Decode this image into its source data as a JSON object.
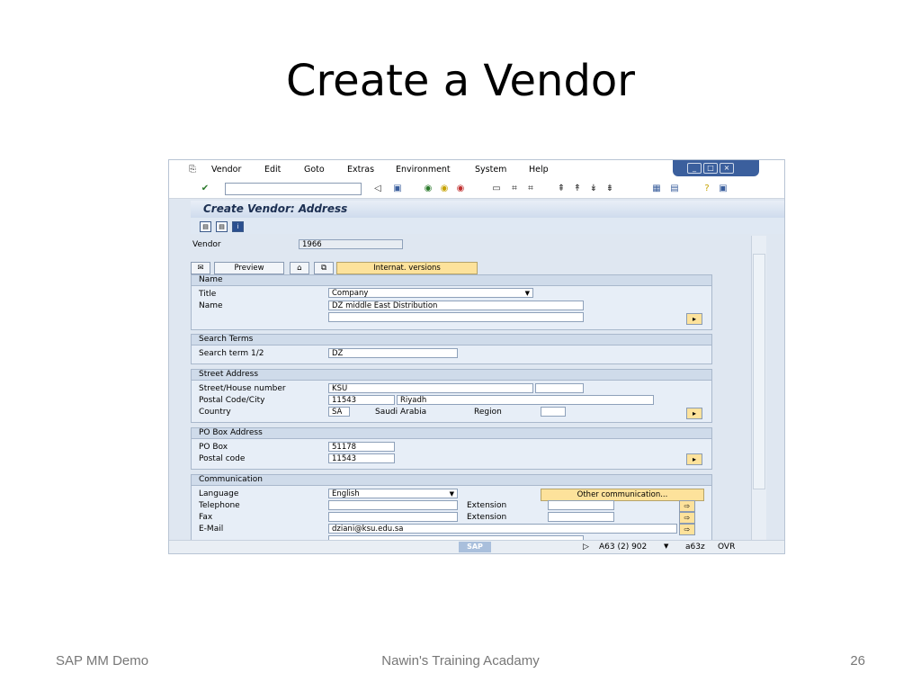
{
  "slide": {
    "title": "Create a Vendor",
    "footer_left": "SAP MM Demo",
    "footer_center": "Nawin's Training Acadamy",
    "footer_right": "26"
  },
  "menu": {
    "items": [
      "Vendor",
      "Edit",
      "Goto",
      "Extras",
      "Environment",
      "System",
      "Help"
    ]
  },
  "screen": {
    "title": "Create Vendor: Address",
    "vendor_label": "Vendor",
    "vendor_value": "1966",
    "preview_label": "Preview",
    "internat_label": "Internat. versions"
  },
  "name_group": {
    "title": "Name",
    "title_label": "Title",
    "title_value": "Company",
    "name_label": "Name",
    "name_value": "DZ middle East Distribution"
  },
  "search_group": {
    "title": "Search Terms",
    "term_label": "Search term 1/2",
    "term_value": "DZ"
  },
  "street_group": {
    "title": "Street Address",
    "street_label": "Street/House number",
    "street_value": "KSU",
    "postal_city_label": "Postal Code/City",
    "postal_value": "11543",
    "city_value": "Riyadh",
    "country_label": "Country",
    "country_value": "SA",
    "country_name": "Saudi Arabia",
    "region_label": "Region"
  },
  "pobox_group": {
    "title": "PO Box Address",
    "pobox_label": "PO Box",
    "pobox_value": "51178",
    "postal_label": "Postal code",
    "postal_value": "11543"
  },
  "comm_group": {
    "title": "Communication",
    "language_label": "Language",
    "language_value": "English",
    "other_comm_label": "Other communication...",
    "telephone_label": "Telephone",
    "fax_label": "Fax",
    "extension_label": "Extension",
    "email_label": "E-Mail",
    "email_value": "dziani@ksu.edu.sa"
  },
  "status": {
    "logo": "SAP",
    "system_info": "A63 (2) 902",
    "server": "a63z",
    "mode": "OVR"
  }
}
